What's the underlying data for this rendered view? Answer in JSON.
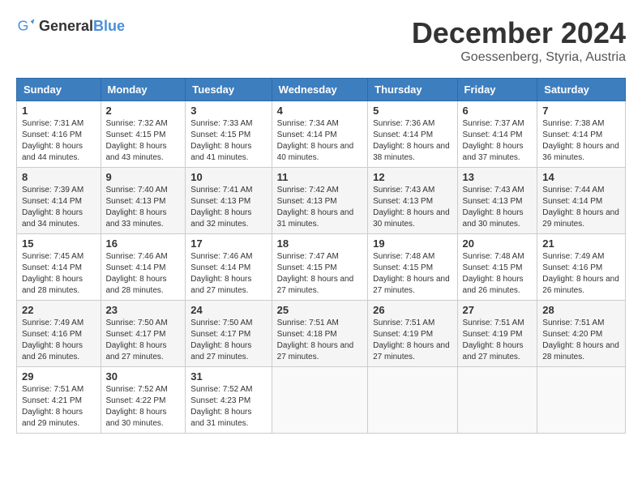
{
  "header": {
    "logo_general": "General",
    "logo_blue": "Blue",
    "month": "December 2024",
    "location": "Goessenberg, Styria, Austria"
  },
  "weekdays": [
    "Sunday",
    "Monday",
    "Tuesday",
    "Wednesday",
    "Thursday",
    "Friday",
    "Saturday"
  ],
  "weeks": [
    [
      {
        "day": "1",
        "sunrise": "7:31 AM",
        "sunset": "4:16 PM",
        "daylight": "8 hours and 44 minutes."
      },
      {
        "day": "2",
        "sunrise": "7:32 AM",
        "sunset": "4:15 PM",
        "daylight": "8 hours and 43 minutes."
      },
      {
        "day": "3",
        "sunrise": "7:33 AM",
        "sunset": "4:15 PM",
        "daylight": "8 hours and 41 minutes."
      },
      {
        "day": "4",
        "sunrise": "7:34 AM",
        "sunset": "4:14 PM",
        "daylight": "8 hours and 40 minutes."
      },
      {
        "day": "5",
        "sunrise": "7:36 AM",
        "sunset": "4:14 PM",
        "daylight": "8 hours and 38 minutes."
      },
      {
        "day": "6",
        "sunrise": "7:37 AM",
        "sunset": "4:14 PM",
        "daylight": "8 hours and 37 minutes."
      },
      {
        "day": "7",
        "sunrise": "7:38 AM",
        "sunset": "4:14 PM",
        "daylight": "8 hours and 36 minutes."
      }
    ],
    [
      {
        "day": "8",
        "sunrise": "7:39 AM",
        "sunset": "4:14 PM",
        "daylight": "8 hours and 34 minutes."
      },
      {
        "day": "9",
        "sunrise": "7:40 AM",
        "sunset": "4:13 PM",
        "daylight": "8 hours and 33 minutes."
      },
      {
        "day": "10",
        "sunrise": "7:41 AM",
        "sunset": "4:13 PM",
        "daylight": "8 hours and 32 minutes."
      },
      {
        "day": "11",
        "sunrise": "7:42 AM",
        "sunset": "4:13 PM",
        "daylight": "8 hours and 31 minutes."
      },
      {
        "day": "12",
        "sunrise": "7:43 AM",
        "sunset": "4:13 PM",
        "daylight": "8 hours and 30 minutes."
      },
      {
        "day": "13",
        "sunrise": "7:43 AM",
        "sunset": "4:13 PM",
        "daylight": "8 hours and 30 minutes."
      },
      {
        "day": "14",
        "sunrise": "7:44 AM",
        "sunset": "4:14 PM",
        "daylight": "8 hours and 29 minutes."
      }
    ],
    [
      {
        "day": "15",
        "sunrise": "7:45 AM",
        "sunset": "4:14 PM",
        "daylight": "8 hours and 28 minutes."
      },
      {
        "day": "16",
        "sunrise": "7:46 AM",
        "sunset": "4:14 PM",
        "daylight": "8 hours and 28 minutes."
      },
      {
        "day": "17",
        "sunrise": "7:46 AM",
        "sunset": "4:14 PM",
        "daylight": "8 hours and 27 minutes."
      },
      {
        "day": "18",
        "sunrise": "7:47 AM",
        "sunset": "4:15 PM",
        "daylight": "8 hours and 27 minutes."
      },
      {
        "day": "19",
        "sunrise": "7:48 AM",
        "sunset": "4:15 PM",
        "daylight": "8 hours and 27 minutes."
      },
      {
        "day": "20",
        "sunrise": "7:48 AM",
        "sunset": "4:15 PM",
        "daylight": "8 hours and 26 minutes."
      },
      {
        "day": "21",
        "sunrise": "7:49 AM",
        "sunset": "4:16 PM",
        "daylight": "8 hours and 26 minutes."
      }
    ],
    [
      {
        "day": "22",
        "sunrise": "7:49 AM",
        "sunset": "4:16 PM",
        "daylight": "8 hours and 26 minutes."
      },
      {
        "day": "23",
        "sunrise": "7:50 AM",
        "sunset": "4:17 PM",
        "daylight": "8 hours and 27 minutes."
      },
      {
        "day": "24",
        "sunrise": "7:50 AM",
        "sunset": "4:17 PM",
        "daylight": "8 hours and 27 minutes."
      },
      {
        "day": "25",
        "sunrise": "7:51 AM",
        "sunset": "4:18 PM",
        "daylight": "8 hours and 27 minutes."
      },
      {
        "day": "26",
        "sunrise": "7:51 AM",
        "sunset": "4:19 PM",
        "daylight": "8 hours and 27 minutes."
      },
      {
        "day": "27",
        "sunrise": "7:51 AM",
        "sunset": "4:19 PM",
        "daylight": "8 hours and 27 minutes."
      },
      {
        "day": "28",
        "sunrise": "7:51 AM",
        "sunset": "4:20 PM",
        "daylight": "8 hours and 28 minutes."
      }
    ],
    [
      {
        "day": "29",
        "sunrise": "7:51 AM",
        "sunset": "4:21 PM",
        "daylight": "8 hours and 29 minutes."
      },
      {
        "day": "30",
        "sunrise": "7:52 AM",
        "sunset": "4:22 PM",
        "daylight": "8 hours and 30 minutes."
      },
      {
        "day": "31",
        "sunrise": "7:52 AM",
        "sunset": "4:23 PM",
        "daylight": "8 hours and 31 minutes."
      },
      null,
      null,
      null,
      null
    ]
  ]
}
